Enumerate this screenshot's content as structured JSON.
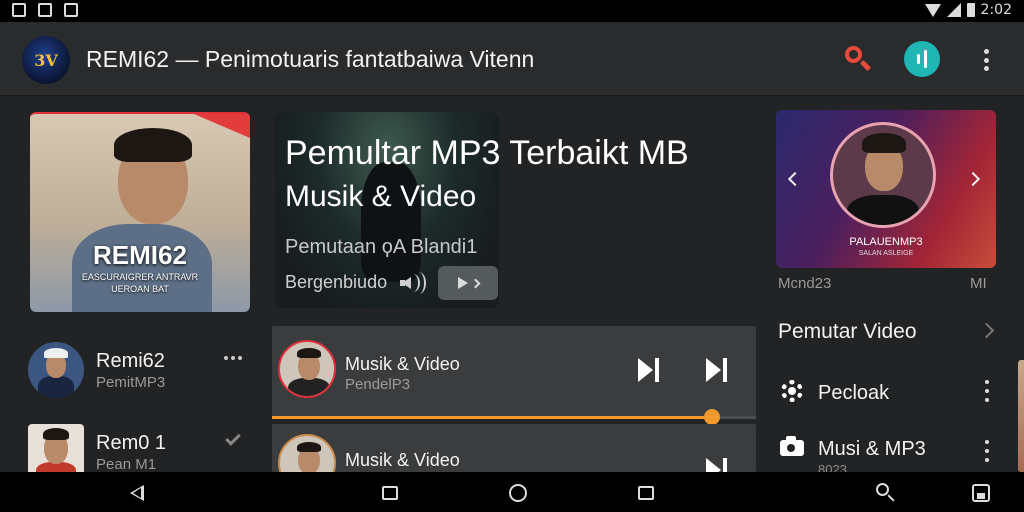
{
  "app_bar": {
    "title": "REMI62 — Penimotuaris fantatbaiwa Vitenn",
    "logo_text": "3V"
  },
  "featured_card": {
    "title": "REMI62",
    "subtitle_1": "EASCURAIGRER ANTRAVR",
    "subtitle_2": "UEROAN BAT"
  },
  "left_list": [
    {
      "title": "Remi62",
      "subtitle": "PemitMP3"
    },
    {
      "title": "Rem0 1",
      "subtitle": "Pean M1"
    }
  ],
  "hero": {
    "title": "Pemultar MP3 Terbaikt MB",
    "title_line2": "Musik & Video",
    "subtitle": "Pemutaan ϙA Blandi1",
    "meta": "Bergenbiudo"
  },
  "player_rows": [
    {
      "title": "Musik & Video",
      "subtitle": "PendelP3",
      "progress": 0.91
    },
    {
      "title": "Musik & Video",
      "subtitle": ""
    }
  ],
  "right_card": {
    "caption": "PALAUENMP3",
    "caption_2": "SALAN ASLEIGE",
    "meta_left": "Mcnd23",
    "meta_right": "MI"
  },
  "right_section": {
    "title": "Pemutar Video",
    "items": [
      {
        "label": "Pecloak",
        "icon": "gear-icon",
        "sub": ""
      },
      {
        "label": "Musi & MP3",
        "icon": "camera-icon",
        "sub": "8023"
      }
    ]
  },
  "status_bar": {
    "time": "2:02"
  },
  "colors": {
    "accent_red": "#e84a3c",
    "accent_teal": "#1fb6b3",
    "seek_orange": "#f29a2e",
    "background": "#222324"
  }
}
